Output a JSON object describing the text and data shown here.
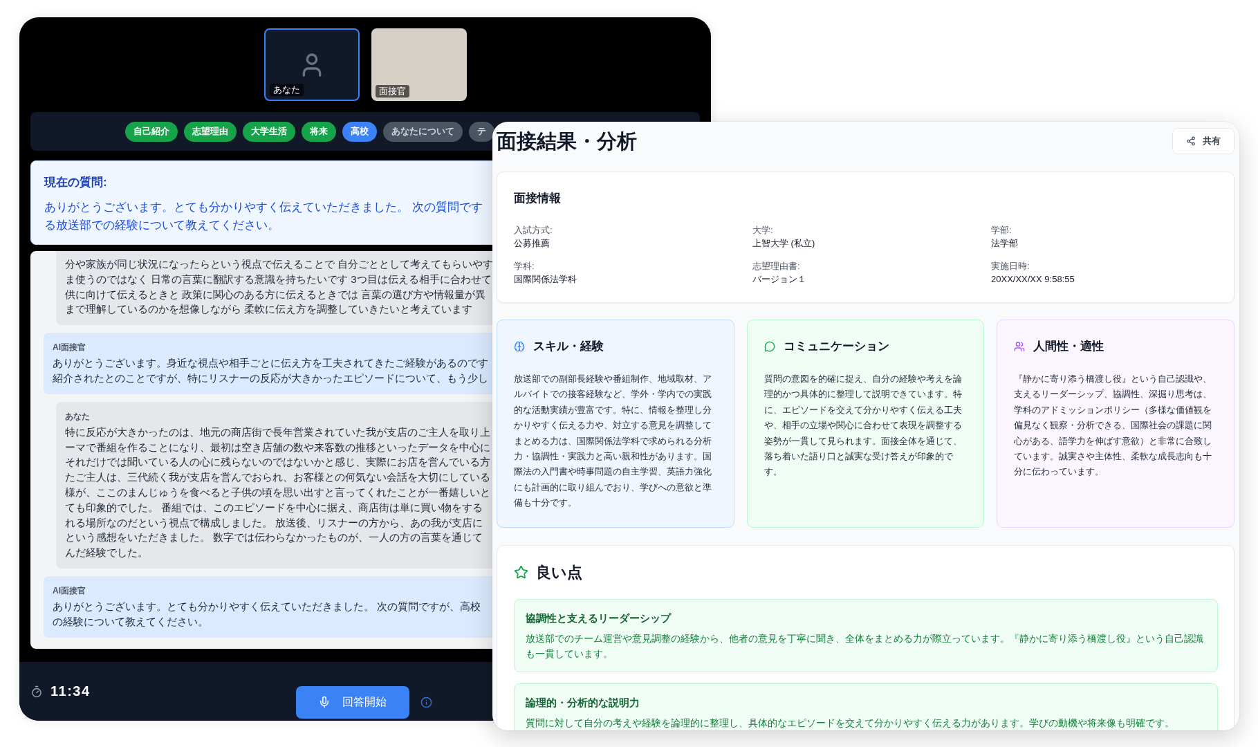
{
  "interview_window": {
    "participants": [
      {
        "label": "あなた",
        "kind": "camera_off",
        "selected": true
      },
      {
        "label": "面接官",
        "kind": "video",
        "selected": false
      }
    ],
    "topics": [
      {
        "label": "自己紹介",
        "completed": true,
        "selected": false
      },
      {
        "label": "志望理由",
        "completed": true,
        "selected": false
      },
      {
        "label": "大学生活",
        "completed": true,
        "selected": false
      },
      {
        "label": "将来",
        "completed": true,
        "selected": false
      },
      {
        "label": "高校",
        "completed": false,
        "selected": true
      },
      {
        "label": "あなたについて",
        "completed": false,
        "selected": false
      },
      {
        "label": "テ",
        "completed": false,
        "selected": false
      }
    ],
    "current_question": {
      "heading": "現在の質問:",
      "lines": [
        "ありがとうございます。とても分かりやすく伝えていただきました。 次の質問です",
        "る放送部での経験について教えてください。"
      ]
    },
    "messages": [
      {
        "kind": "candidate",
        "lines": [
          "分や家族が同じ状況になったらという視点で伝えることで 自分ごととして考えてもらいやす",
          "ま使うのではなく 日常の言葉に翻訳する意識を持ちたいです 3つ目は伝える相手に合わせて",
          "供に向けて伝えるときと 政策に関心のある方に伝えるときでは 言葉の選び方や情報量が異",
          "まで理解しているのかを想像しながら 柔軟に伝え方を調整していきたいと考えています"
        ]
      },
      {
        "kind": "interviewer",
        "speaker": "AI面接官",
        "lines": [
          "ありがとうございます。身近な視点や相手ごとに伝え方を工夫されてきたご経験があるのです",
          "紹介されたとのことですが、特にリスナーの反応が大きかったエピソードについて、もう少し"
        ]
      },
      {
        "kind": "candidate",
        "speaker": "あなた",
        "lines": [
          "特に反応が大きかったのは、地元の商店街で長年営業されていた我が支店のご主人を取り上",
          "ーマで番組を作ることになり、最初は空き店舗の数や来客数の推移といったデータを中心に",
          "それだけでは聞いている人の心に残らないのではないかと感じ、実際にお店を営んでいる方",
          "たご主人は、三代続く我が支店を営んでおられ、お客様との何気ない会話を大切にしている",
          "様が、ここのまんじゅうを食べると子供の頃を思い出すと言ってくれたことが一番嬉しいと",
          "ても印象的でした。 番組では、このエピソードを中心に据え、商店街は単に買い物をする",
          "れる場所なのだという視点で構成しました。 放送後、リスナーの方から、あの我が支店に",
          "という感想をいただきました。 数字では伝わらなかったものが、一人の方の言葉を通じて",
          "んだ経験でした。"
        ]
      },
      {
        "kind": "interviewer",
        "speaker": "AI面接官",
        "lines": [
          "ありがとうございます。とても分かりやすく伝えていただきました。 次の質問ですが、高校",
          "の経験について教えてください。"
        ]
      }
    ],
    "timer": "11:34",
    "answer_button": "回答開始"
  },
  "results_panel": {
    "title": "面接結果・分析",
    "share_button": "共有",
    "info": {
      "heading": "面接情報",
      "fields": [
        {
          "label": "入試方式:",
          "value": "公募推薦"
        },
        {
          "label": "大学:",
          "value": "上智大学 (私立)"
        },
        {
          "label": "学部:",
          "value": "法学部"
        },
        {
          "label": "学科:",
          "value": "国際関係法学科"
        },
        {
          "label": "志望理由書:",
          "value": "バージョン１"
        },
        {
          "label": "実施日時:",
          "value": "20XX/XX/XX 9:58:55"
        }
      ]
    },
    "assessments": [
      {
        "kind": "skills",
        "title": "スキル・経験",
        "text": "放送部での副部長経験や番組制作、地域取材、アルバイトでの接客経験など、学外・学内での実践的な活動実績が豊富です。特に、情報を整理し分かりやすく伝える力や、対立する意見を調整してまとめる力は、国際関係法学科で求められる分析力・協調性・実践力と高い親和性があります。国際法の入門書や時事問題の自主学習、英語力強化にも計画的に取り組んでおり、学びへの意欲と準備も十分です。"
      },
      {
        "kind": "communication",
        "title": "コミュニケーション",
        "text": "質問の意図を的確に捉え、自分の経験や考えを論理的かつ具体的に整理して説明できています。特に、エピソードを交えて分かりやすく伝える工夫や、相手の立場や関心に合わせて表現を調整する姿勢が一貫して見られます。面接全体を通じて、落ち着いた語り口と誠実な受け答えが印象的です。"
      },
      {
        "kind": "personality",
        "title": "人間性・適性",
        "text": "『静かに寄り添う橋渡し役』という自己認識や、支えるリーダーシップ、協調性、深掘り思考は、学科のアドミッションポリシー（多様な価値観を偏見なく観察・分析できる、国際社会の課題に関心がある、語学力を伸ばす意欲）と非常に合致しています。誠実さや主体性、柔軟な成長志向も十分に伝わっています。"
      }
    ],
    "strengths": {
      "heading": "良い点",
      "items": [
        {
          "title": "協調性と支えるリーダーシップ",
          "text": "放送部でのチーム運営や意見調整の経験から、他者の意見を丁寧に聞き、全体をまとめる力が際立っています。『静かに寄り添う橋渡し役』という自己認識も一貫しています。"
        },
        {
          "title": "論理的・分析的な説明力",
          "text": "質問に対して自分の考えや経験を論理的に整理し、具体的なエピソードを交えて分かりやすく伝える力があります。学びの動機や将来像も明確です。"
        }
      ]
    }
  }
}
